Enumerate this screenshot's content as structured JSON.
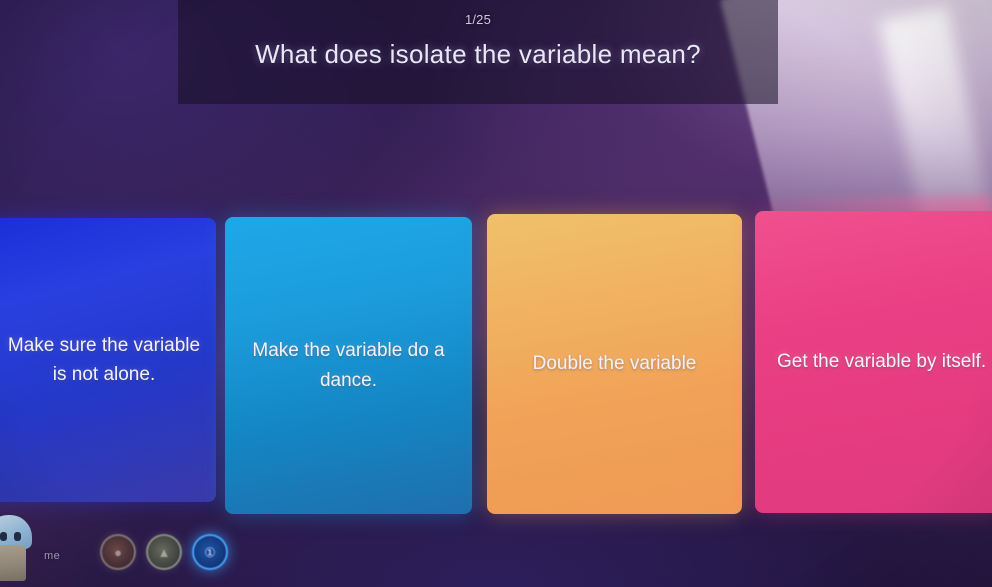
{
  "quiz": {
    "counter": "1/25",
    "question": "What does isolate the variable mean?",
    "answers": [
      {
        "label": "Make sure the variable is not alone.",
        "color": "#2438c9",
        "name": "answer-option-blue"
      },
      {
        "label": "Make the variable do a dance.",
        "color": "#1c9ddd",
        "name": "answer-option-cyan"
      },
      {
        "label": "Double the variable",
        "color": "#f0b462",
        "name": "answer-option-orange"
      },
      {
        "label": "Get the variable by itself.",
        "color": "#ea3f84",
        "name": "answer-option-pink"
      }
    ]
  },
  "player_bar": {
    "me_label": "me",
    "avatar_icon": "player-avatar-icon",
    "badges": [
      {
        "icon": "player-badge-icon",
        "glyph": "●",
        "state": "dim"
      },
      {
        "icon": "player-badge-icon",
        "glyph": "▲",
        "state": "dim"
      },
      {
        "icon": "player-badge-icon",
        "glyph": "①",
        "state": "active"
      }
    ]
  },
  "colors": {
    "background": "#3a245c",
    "banner": "#160e24",
    "accent_blue": "#2438c9",
    "accent_cyan": "#1c9ddd",
    "accent_orange": "#f0b462",
    "accent_pink": "#ea3f84",
    "text": "#e9e6f7"
  }
}
